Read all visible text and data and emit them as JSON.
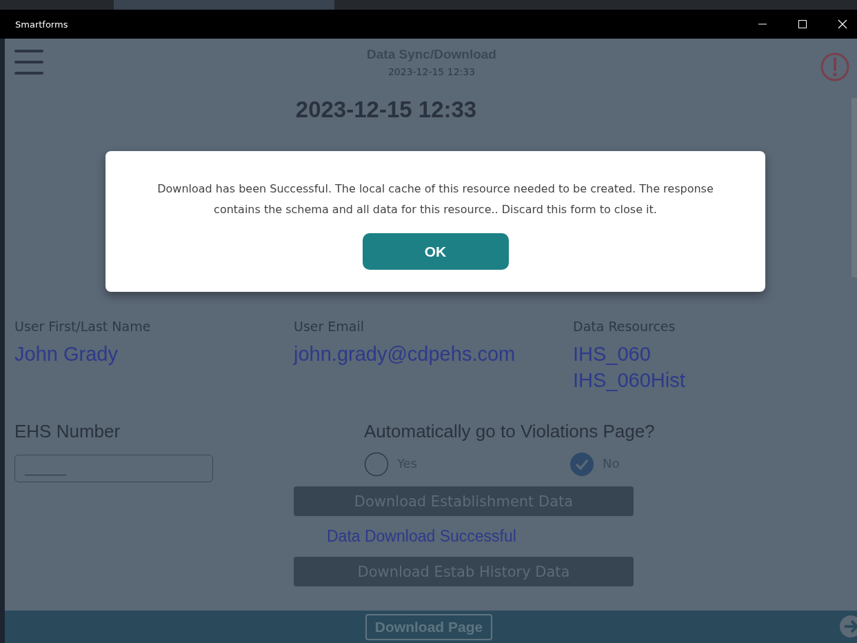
{
  "window": {
    "title": "Smartforms"
  },
  "header": {
    "title": "Data Sync/Download",
    "subtitle": "2023-12-15 12:33"
  },
  "sync_time": "2023-12-15 12:33",
  "dialog": {
    "message": "Download has been Successful. The local cache of this resource needed to be created. The response contains the schema and all data for this resource.. Discard this form to close it.",
    "button": "OK"
  },
  "user_name": {
    "label": "User First/Last Name",
    "value": "John Grady"
  },
  "user_email": {
    "label": "User Email",
    "value": "john.grady@cdpehs.com"
  },
  "data_resources": {
    "label": "Data Resources",
    "values": [
      "IHS_060",
      "IHS_060Hist"
    ]
  },
  "ehs_number": {
    "label": "EHS Number",
    "value": "______"
  },
  "violations_page": {
    "question": "Automatically go to Violations Page?",
    "options": [
      {
        "label": "Yes",
        "selected": false
      },
      {
        "label": "No",
        "selected": true
      }
    ]
  },
  "actions": [
    {
      "kind": "button",
      "label": "Download Establishment Data",
      "disabled": true
    },
    {
      "kind": "status",
      "label": "Data Download Successful"
    },
    {
      "kind": "button",
      "label": "Download Estab History Data",
      "disabled": true
    }
  ],
  "footer": {
    "button": "Download Page"
  }
}
